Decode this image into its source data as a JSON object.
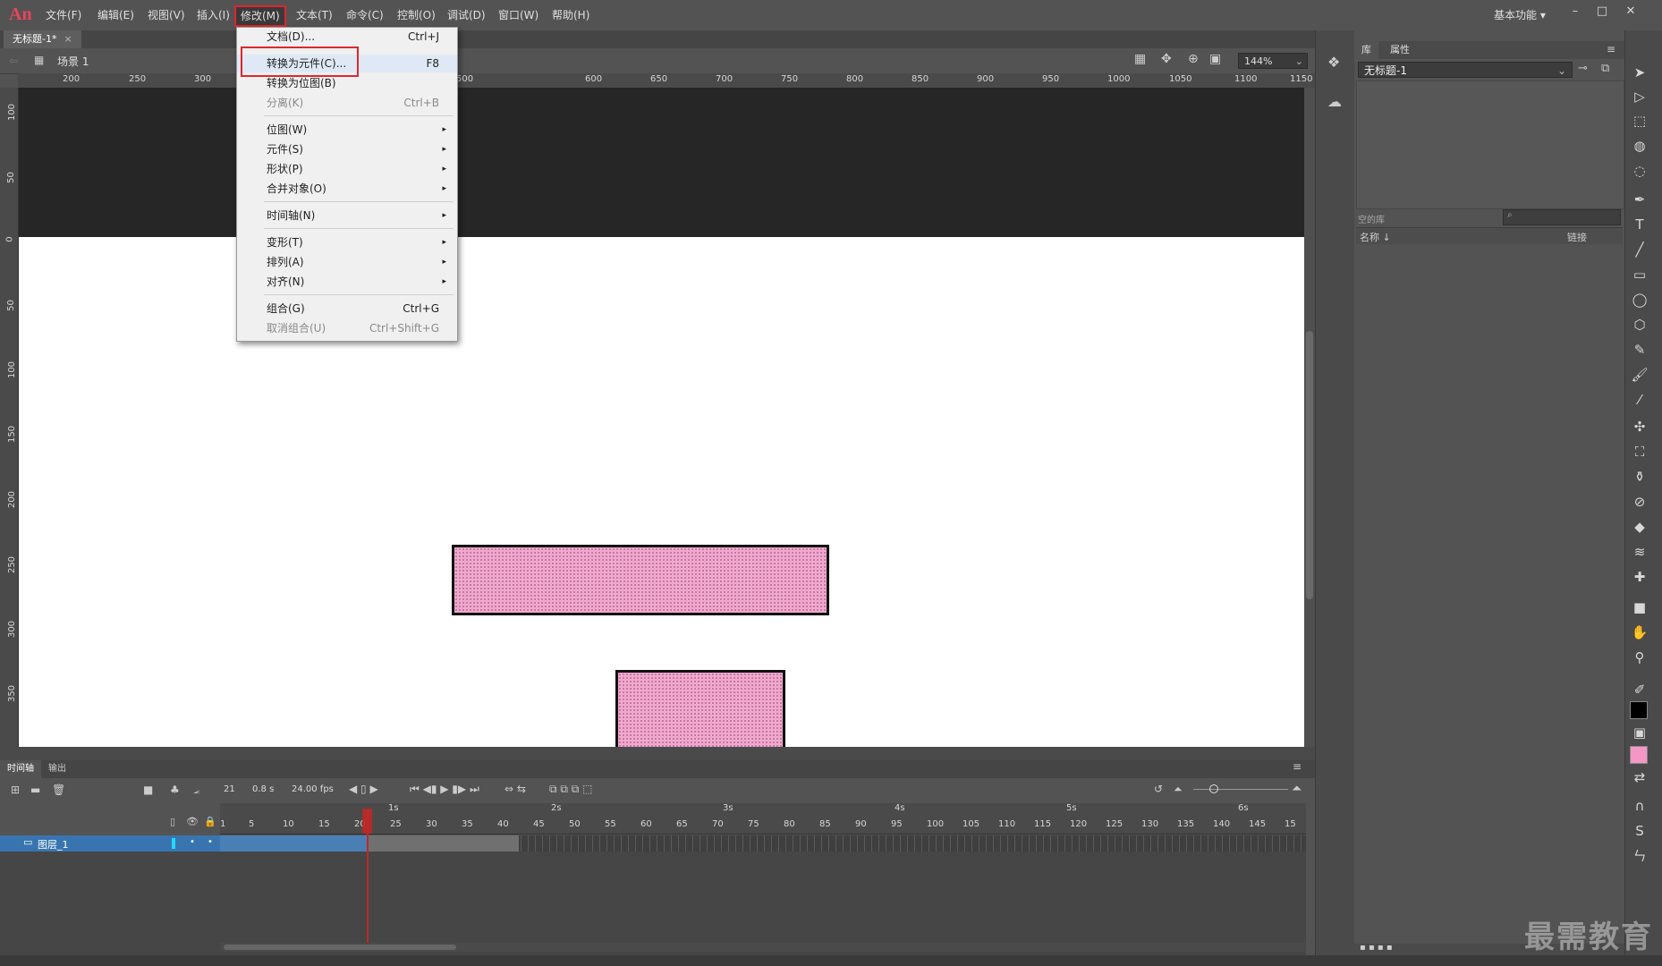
{
  "app": {
    "logo": "An"
  },
  "menubar": {
    "items": [
      "文件(F)",
      "编辑(E)",
      "视图(V)",
      "插入(I)",
      "修改(M)",
      "文本(T)",
      "命令(C)",
      "控制(O)",
      "调试(D)",
      "窗口(W)",
      "帮助(H)"
    ],
    "active": "修改(M)",
    "workspace": "基本功能",
    "window_buttons": [
      "–",
      "□",
      "✕"
    ]
  },
  "document": {
    "tab_title": "无标题-1*",
    "tab_close": "×",
    "scene": "场景 1",
    "zoom": "144%"
  },
  "rulers": {
    "horizontal": [
      "200",
      "250",
      "300",
      "600",
      "650",
      "700",
      "750",
      "800",
      "850",
      "900",
      "950",
      "1000",
      "1050",
      "1100",
      "1150",
      "500"
    ],
    "vertical": [
      "100",
      "50",
      "0",
      "50",
      "100",
      "150",
      "200",
      "250",
      "300",
      "350"
    ]
  },
  "modify_menu": {
    "items": [
      {
        "label": "文档(D)...",
        "shortcut": "Ctrl+J"
      },
      {
        "label": "转换为元件(C)...",
        "shortcut": "F8",
        "highlighted": true
      },
      {
        "label": "转换为位图(B)",
        "shortcut": ""
      },
      {
        "label": "分离(K)",
        "shortcut": "Ctrl+B",
        "disabled": true
      },
      {
        "label": "位图(W)",
        "submenu": true
      },
      {
        "label": "元件(S)",
        "submenu": true
      },
      {
        "label": "形状(P)",
        "submenu": true
      },
      {
        "label": "合并对象(O)",
        "submenu": true
      },
      {
        "label": "时间轴(N)",
        "submenu": true
      },
      {
        "label": "变形(T)",
        "submenu": true
      },
      {
        "label": "排列(A)",
        "submenu": true
      },
      {
        "label": "对齐(N)",
        "submenu": true
      },
      {
        "label": "组合(G)",
        "shortcut": "Ctrl+G"
      },
      {
        "label": "取消组合(U)",
        "shortcut": "Ctrl+Shift+G",
        "disabled": true
      }
    ],
    "arrow": "▸"
  },
  "timeline": {
    "tabs": [
      "时间轴",
      "输出"
    ],
    "current_frame": "21",
    "time": "0.8 s",
    "fps": "24.00 fps",
    "second_marks": [
      "1s",
      "2s",
      "3s",
      "4s",
      "5s",
      "6s"
    ],
    "frame_numbers": [
      "1",
      "5",
      "10",
      "15",
      "20",
      "25",
      "30",
      "35",
      "40",
      "45",
      "50",
      "55",
      "60",
      "65",
      "70",
      "75",
      "80",
      "85",
      "90",
      "95",
      "100",
      "105",
      "110",
      "115",
      "120",
      "125",
      "130",
      "135",
      "140",
      "145",
      "15"
    ],
    "layer": {
      "name": "图层_1"
    }
  },
  "library": {
    "tabs": [
      "库",
      "属性"
    ],
    "document_select": "无标题-1",
    "empty_label": "空的库",
    "col_name": "名称 ↓",
    "col_link": "链接"
  },
  "colors": {
    "stroke": "#000000",
    "fill": "#f497c7",
    "shape_fill": "#f0a9cd",
    "highlight_red": "#e0262e"
  },
  "watermark": "最需教育"
}
